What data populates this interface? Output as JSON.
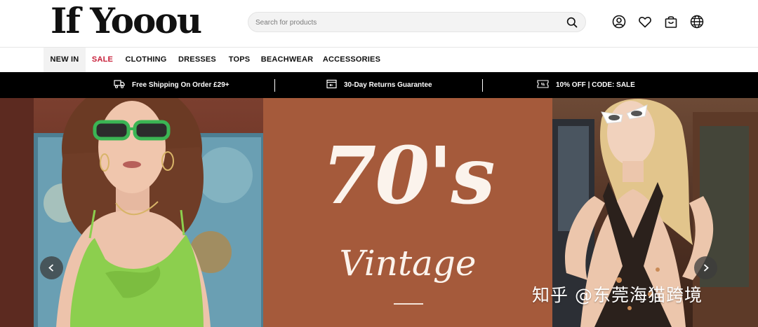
{
  "brand": {
    "logo_text": "If Yooou"
  },
  "search": {
    "placeholder": "Search for products"
  },
  "header_icons": [
    "user-account-icon",
    "wishlist-heart-icon",
    "shopping-bag-icon",
    "language-globe-icon"
  ],
  "nav": {
    "items": [
      {
        "label": "NEW IN",
        "active": true
      },
      {
        "label": "SALE",
        "highlight_color": "#c8203a"
      },
      {
        "label": "CLOTHING"
      },
      {
        "label": "DRESSES"
      },
      {
        "label": "TOPS"
      },
      {
        "label": "BEACHWEAR"
      },
      {
        "label": "ACCESSORIES"
      }
    ]
  },
  "promo_bar": {
    "items": [
      {
        "icon": "truck-icon",
        "text": "Free Shipping On Order £29+"
      },
      {
        "icon": "return-box-icon",
        "text": "30-Day Returns Guarantee"
      },
      {
        "icon": "discount-tag-icon",
        "text": "10% OFF | CODE: SALE"
      }
    ]
  },
  "hero": {
    "headline": "70's",
    "subheadline": "Vintage",
    "center_bg_color": "#a55a3b"
  },
  "watermark": {
    "text": "知乎 @东莞海猫跨境"
  }
}
